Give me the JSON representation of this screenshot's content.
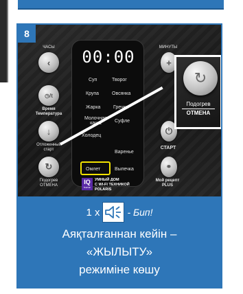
{
  "step_number": "8",
  "panel": {
    "display_time": "00:00",
    "left_labels": {
      "hours": "ЧАСЫ",
      "time_temp": "Время\nТемпература",
      "delayed_start": "Отложенный старт",
      "keep_warm": "Подогрев\nОТМЕНА"
    },
    "right_labels": {
      "minutes": "МИНУТЫ",
      "start": "СТАРТ",
      "my_recipe": "Мой рецепт\nPLUS"
    },
    "programs": [
      {
        "label": "Суп"
      },
      {
        "label": "Творог"
      },
      {
        "label": "Крупа"
      },
      {
        "label": "Овсянка"
      },
      {
        "label": "Жарка"
      },
      {
        "label": "Гречка"
      },
      {
        "label": "Молочная\nкаша"
      },
      {
        "label": "Суфле"
      },
      {
        "label": "Холодец"
      },
      {
        "label": "Варенье"
      },
      {
        "label": "Омлет"
      },
      {
        "label": "Выпечка"
      }
    ],
    "highlighted_program": "Омлет",
    "iq_logo": {
      "text": "IQ",
      "sub": "home"
    },
    "smart_home_text": "УМНЫЙ ДОМ\nС WI-FI ТЕХНИКОЙ\nPOLARIS",
    "zoom": {
      "label_top": "Подогрев",
      "label_bottom": "ОТМЕНА"
    }
  },
  "caption": {
    "beep_count": "1 x",
    "beep_label": "- Бип!",
    "line1": "Аяқталғаннан кейін –",
    "line2": "«ЖЫЛЫТУ»",
    "line3": "режиміне көшу"
  },
  "colors": {
    "accent_blue": "#2e76b8",
    "highlight_yellow": "#f2e200"
  },
  "icons": [
    "speaker-icon",
    "arrow-left-icon",
    "plus-icon",
    "arrow-down-icon",
    "refresh-icon",
    "chef-hat-icon"
  ]
}
